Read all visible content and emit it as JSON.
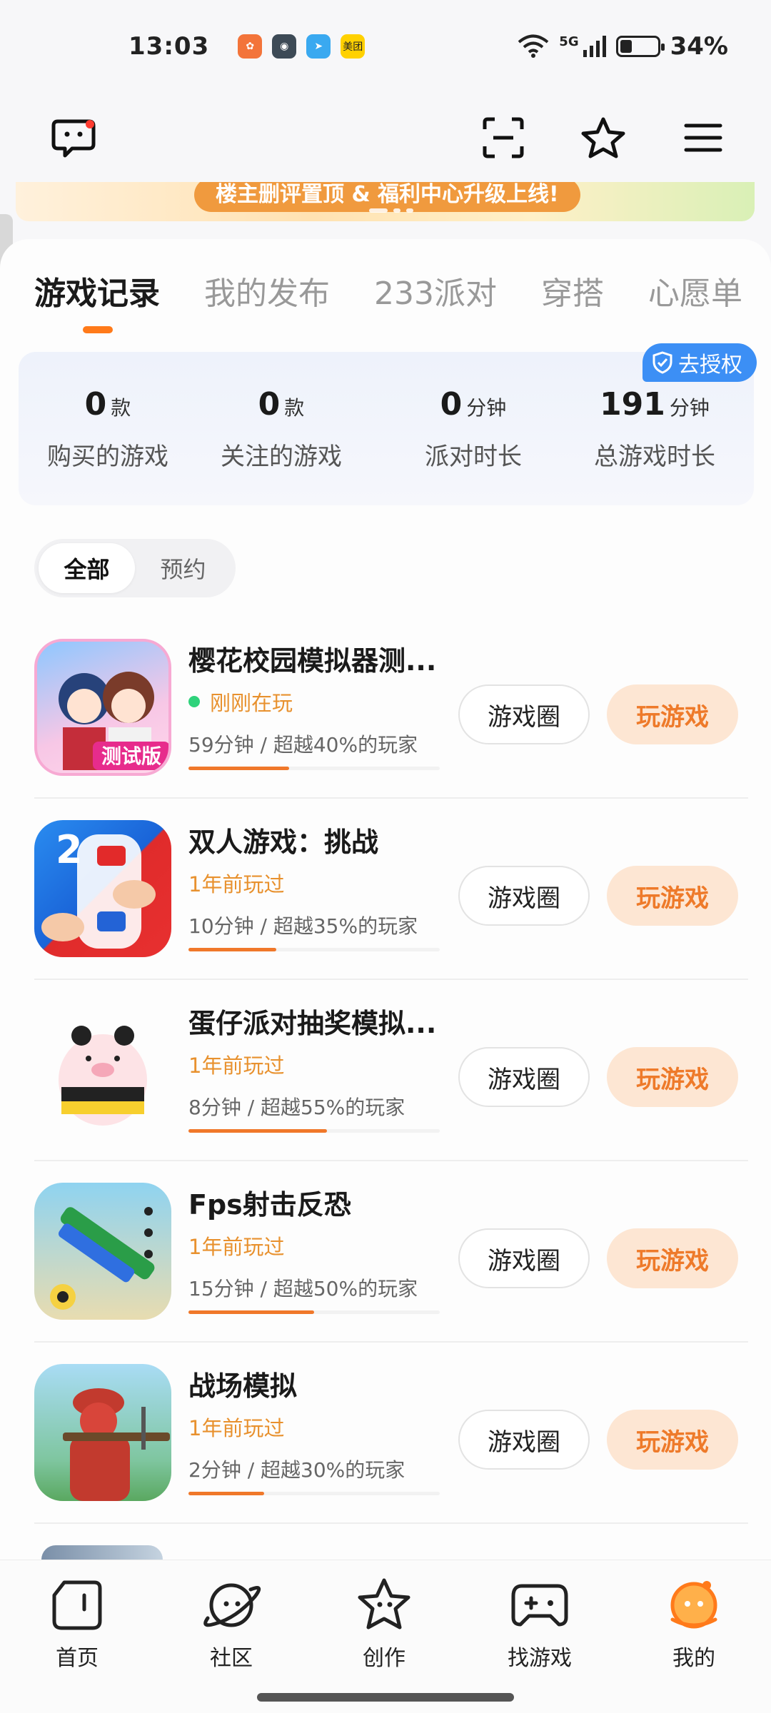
{
  "status_bar": {
    "time": "13:03",
    "battery": "34%",
    "network": "5G",
    "apps": [
      "美团"
    ]
  },
  "banner": {
    "text": "楼主删评置顶 & 福利中心升级上线!"
  },
  "tabs": [
    "游戏记录",
    "我的发布",
    "233派对",
    "穿搭",
    "心愿单"
  ],
  "auth_badge": "去授权",
  "stats": [
    {
      "num": "0",
      "unit": "款",
      "label": "购买的游戏"
    },
    {
      "num": "0",
      "unit": "款",
      "label": "关注的游戏"
    },
    {
      "num": "0",
      "unit": "分钟",
      "label": "派对时长"
    },
    {
      "num": "191",
      "unit": "分钟",
      "label": "总游戏时长"
    }
  ],
  "filters": [
    "全部",
    "预约"
  ],
  "games": [
    {
      "name": "樱花校园模拟器测...",
      "status": "刚刚在玩",
      "meta": "59分钟 / 超越40%的玩家",
      "progress": 0.4,
      "icon_text": "测试版"
    },
    {
      "name": "双人游戏：挑战",
      "status": "1年前玩过",
      "meta": "10分钟 / 超越35%的玩家",
      "progress": 0.35,
      "icon_text": "2"
    },
    {
      "name": "蛋仔派对抽奖模拟...",
      "status": "1年前玩过",
      "meta": "8分钟 / 超越55%的玩家",
      "progress": 0.55,
      "icon_text": ""
    },
    {
      "name": "Fps射击反恐",
      "status": "1年前玩过",
      "meta": "15分钟 / 超越50%的玩家",
      "progress": 0.5,
      "icon_text": ""
    },
    {
      "name": "战场模拟",
      "status": "1年前玩过",
      "meta": "2分钟 / 超越30%的玩家",
      "progress": 0.3,
      "icon_text": ""
    }
  ],
  "buttons": {
    "circle": "游戏圈",
    "play": "玩游戏"
  },
  "bottom_nav": [
    "首页",
    "社区",
    "创作",
    "找游戏",
    "我的"
  ],
  "colors": {
    "accent": "#ff7a1a",
    "play_bg": "#fde6d3",
    "online": "#2fd27b",
    "badge": "#3c8ff5"
  }
}
